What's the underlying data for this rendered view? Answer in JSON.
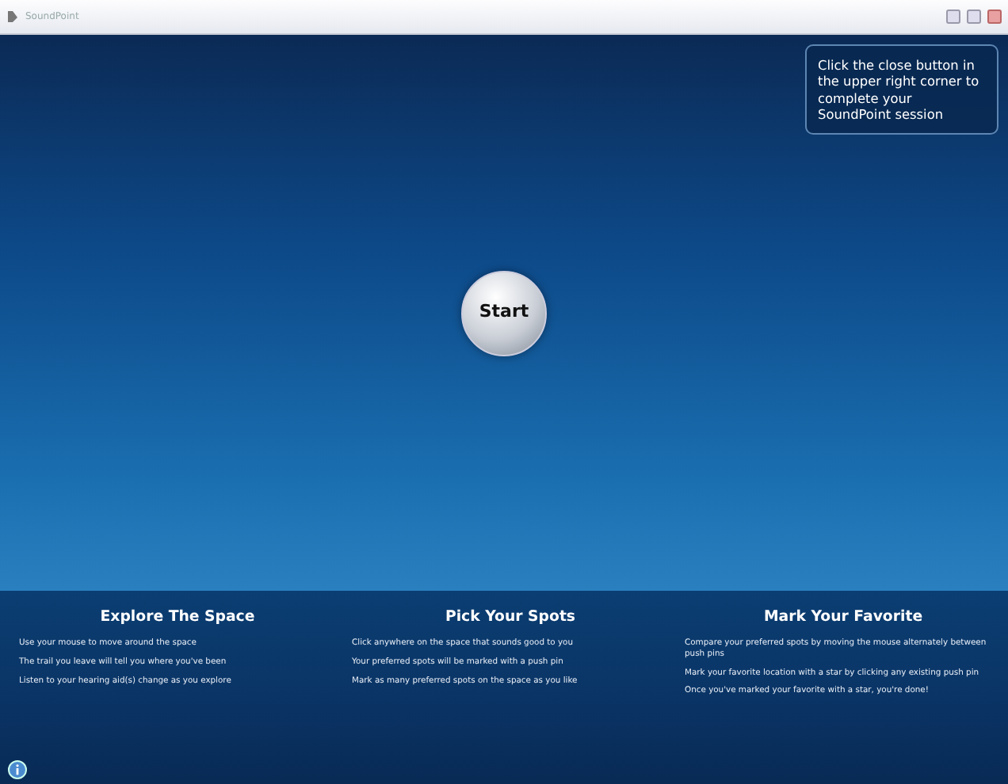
{
  "window": {
    "title": "SoundPoint"
  },
  "hint": "Click the close button in the upper right corner to complete your SoundPoint session",
  "start_button": "Start",
  "sections": [
    {
      "title": "Explore The Space",
      "steps": [
        "Use your mouse to move around the space",
        "The trail you leave will tell you where you've been",
        "Listen to your hearing aid(s) change as you explore"
      ]
    },
    {
      "title": "Pick Your Spots",
      "steps": [
        "Click anywhere on the space that sounds good to you",
        "Your preferred spots will be marked with a push pin",
        "Mark as many preferred spots on the space as you like"
      ]
    },
    {
      "title": "Mark Your Favorite",
      "steps": [
        "Compare your preferred spots by moving the mouse alternately between push pins",
        "Mark your favorite location with a star by clicking any existing push pin",
        "Once you've marked your favorite with a star, you're done!"
      ]
    }
  ]
}
